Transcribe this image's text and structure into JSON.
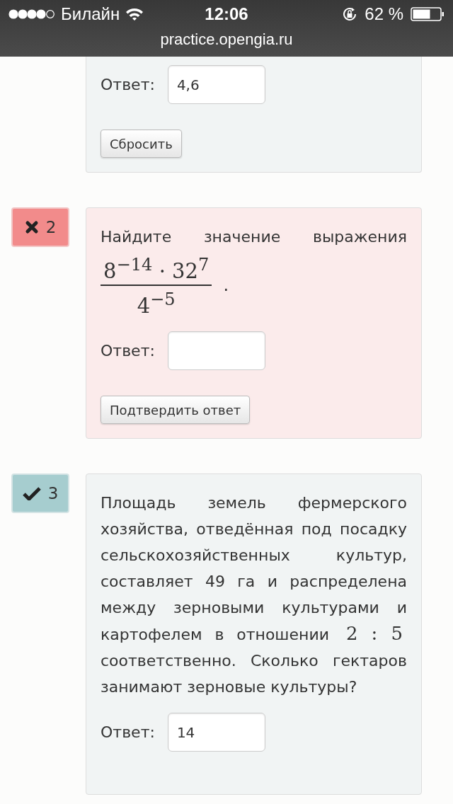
{
  "status_bar": {
    "carrier": "Билайн",
    "time": "12:06",
    "battery": "62 %"
  },
  "address_bar": {
    "url": "practice.opengia.ru"
  },
  "problems": [
    {
      "correct": true,
      "answer_label": "Ответ:",
      "answer_value": "4,6",
      "button": "Сбросить"
    },
    {
      "correct": false,
      "number": "2",
      "question": {
        "kind": "fraction",
        "before": "Найдите значение выражения",
        "numerator": "8$^{−14}$ · 32$^{7}$",
        "denominator": "4$^{−5}$",
        "after": "."
      },
      "answer_label": "Ответ:",
      "button": "Подтвердить ответ"
    },
    {
      "correct": true,
      "number": "3",
      "question": {
        "kind": "inline",
        "before": "Площадь земель фермерского хозяйства, отведённая под посадку сельскохозяйственных культур, составляет 49 га и распределена между зерновыми культурами и картофелем в отношении",
        "math": "2 : 5",
        "after": "соответственно. Сколько гектаров занимают зерновые культуры?"
      },
      "answer_label": "Ответ:",
      "answer_value": "14"
    }
  ]
}
